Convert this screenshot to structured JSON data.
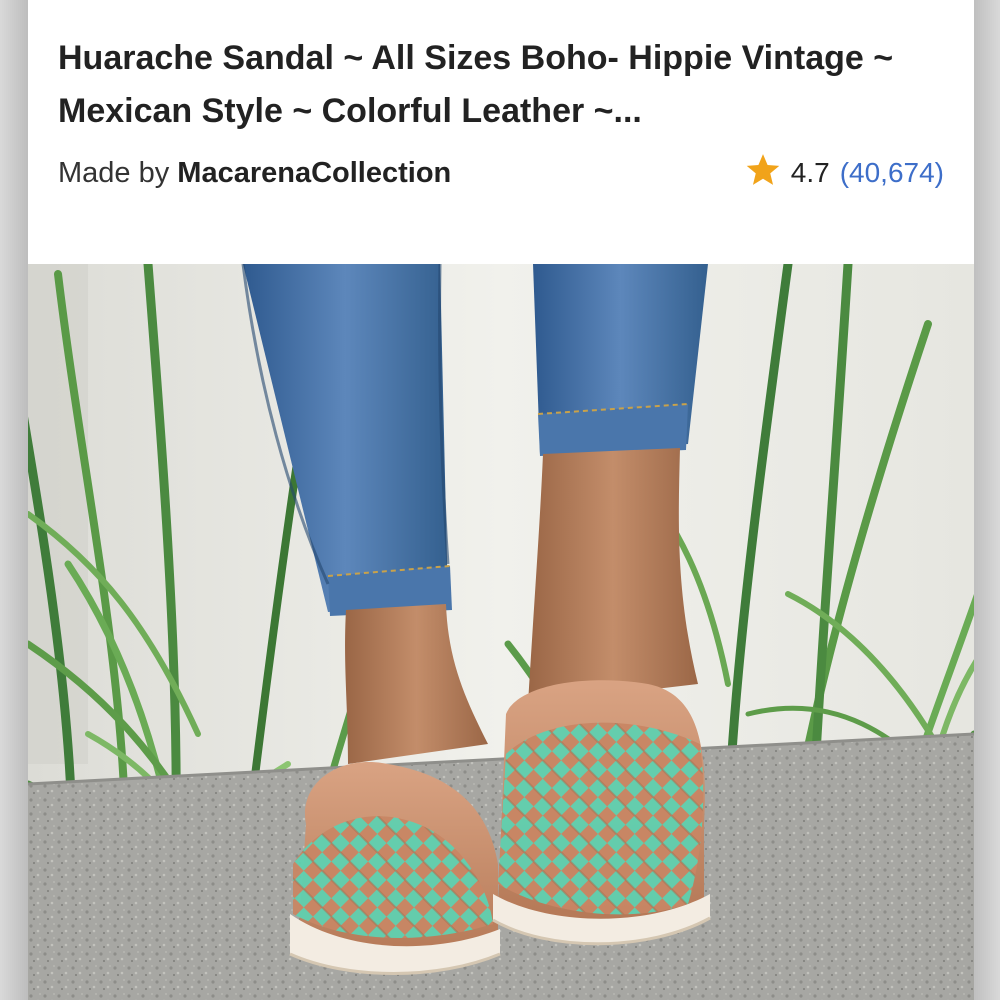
{
  "listing": {
    "title": "Huarache Sandal ~ All Sizes Boho- Hippie Vintage ~ Mexican Style ~ Colorful Leather ~...",
    "made_by_label": "Made by",
    "shop_name": "MacarenaCollection",
    "rating": "4.7",
    "review_count": "(40,674)"
  },
  "photo": {
    "subject": "product-photo-woven-leather-huarache-sandals",
    "icon": "star-icon"
  },
  "colors": {
    "title_text": "#222222",
    "review_link": "#3d6ec9",
    "star": "#f1a31a",
    "sandal_leather": "#c98a66",
    "sandal_turquoise": "#5fd0b0",
    "jeans": "#3f6ea8"
  }
}
